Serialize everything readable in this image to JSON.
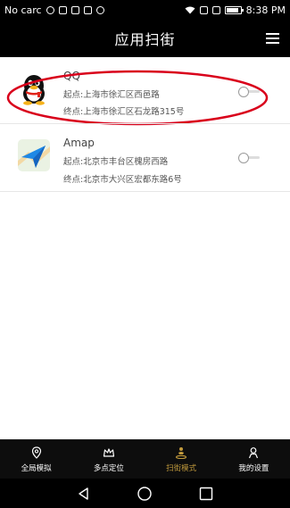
{
  "status_bar": {
    "carrier": "No carc",
    "time": "8:38 PM"
  },
  "header": {
    "title": "应用扫街"
  },
  "apps": [
    {
      "name": "QQ",
      "start": "起点:上海市徐汇区西邑路",
      "end": "终点:上海市徐汇区石龙路315号",
      "enabled": false,
      "highlighted": true
    },
    {
      "name": "Amap",
      "start": "起点:北京市丰台区槐房西路",
      "end": "终点:北京市大兴区宏都东路6号",
      "enabled": false,
      "highlighted": false
    }
  ],
  "tabs": [
    {
      "label": "全局模拟",
      "icon": "location-pin-icon",
      "active": false
    },
    {
      "label": "多点定位",
      "icon": "crown-icon",
      "active": false
    },
    {
      "label": "扫街模式",
      "icon": "street-walk-icon",
      "active": true
    },
    {
      "label": "我的设置",
      "icon": "person-icon",
      "active": false
    }
  ],
  "colors": {
    "accent": "#c19a3c",
    "highlight": "#d9001b",
    "bar": "#000000"
  }
}
